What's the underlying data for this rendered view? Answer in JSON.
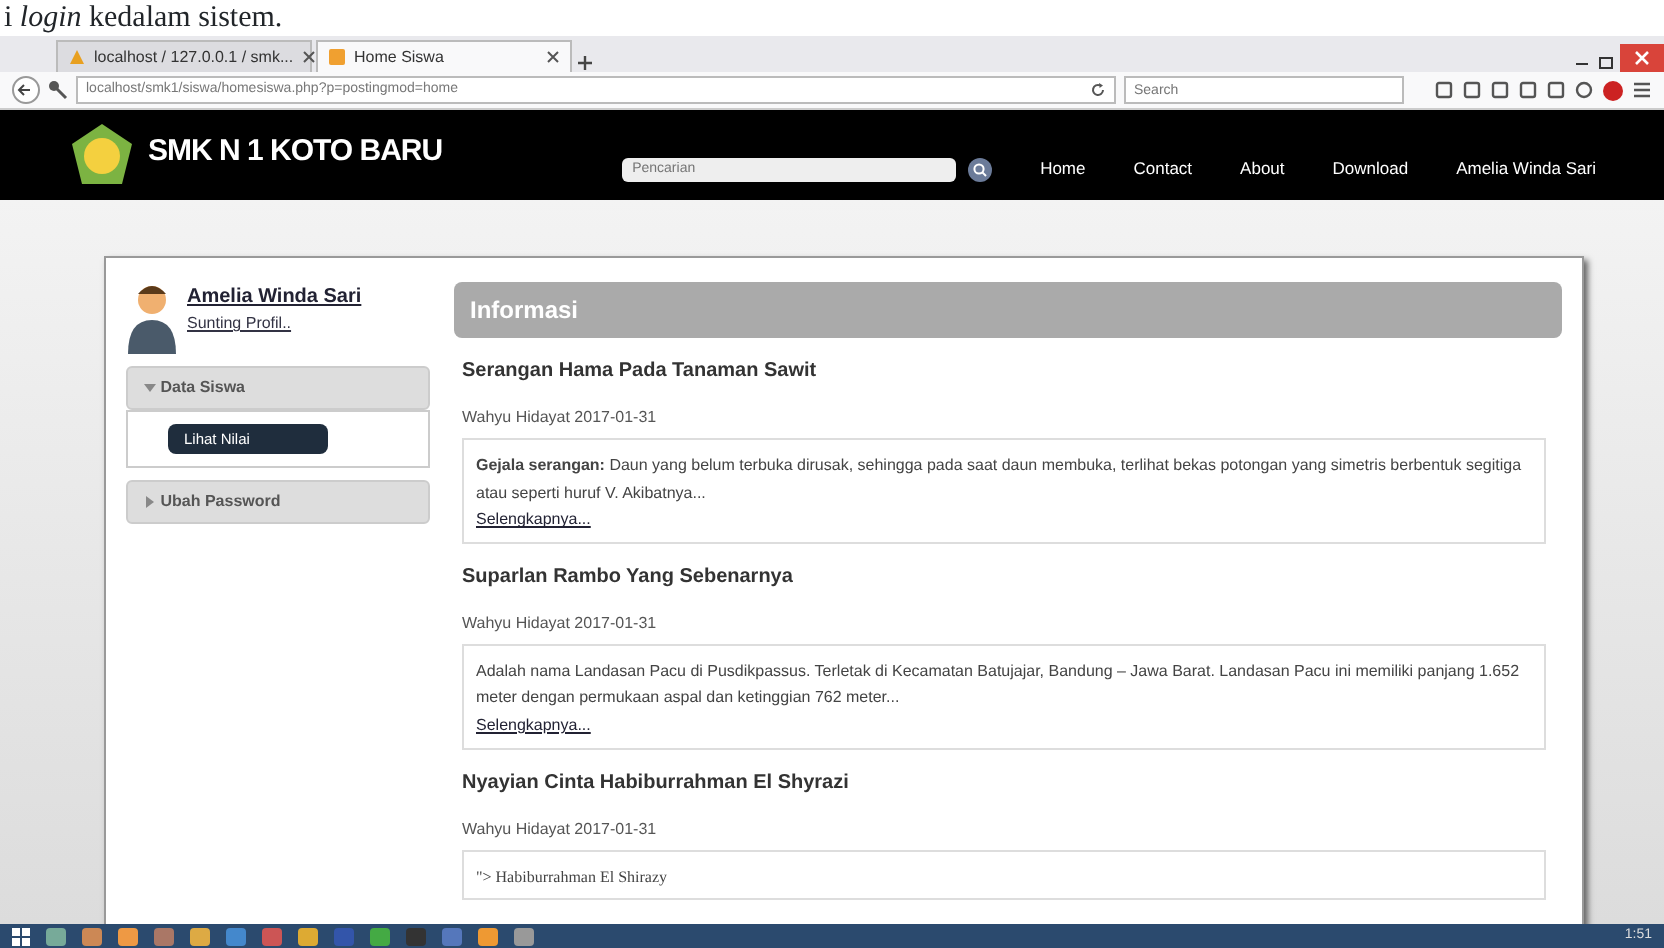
{
  "document_text": "i *login* kedalam sistem.",
  "browser": {
    "tabs": [
      {
        "title": "localhost / 127.0.0.1 / smk...",
        "selected": false
      },
      {
        "title": "Home Siswa",
        "selected": true
      }
    ],
    "url": "localhost/smk1/siswa/homesiswa.php?p=postingmod=home",
    "search_placeholder": "Search"
  },
  "navbar": {
    "brand": "SMK N 1 KOTO BARU",
    "search_placeholder": "Pencarian",
    "links": [
      "Home",
      "Contact",
      "About",
      "Download",
      "Amelia Winda Sari"
    ]
  },
  "sidebar": {
    "user_name": "Amelia Winda Sari",
    "edit_profile": "Sunting Profil..",
    "menus": [
      {
        "label": "Data Siswa",
        "expanded": true,
        "children": [
          {
            "label": "Lihat Nilai",
            "selected": true
          }
        ]
      },
      {
        "label": "Ubah Password",
        "expanded": false
      }
    ]
  },
  "content": {
    "heading": "Informasi",
    "posts": [
      {
        "title": "Serangan Hama Pada Tanaman Sawit",
        "meta": "Wahyu Hidayat 2017-01-31",
        "excerpt": "**Gejala serangan:** Daun yang belum terbuka dirusak, sehingga pada saat daun membuka, terlihat bekas potongan yang simetris berbentuk segitiga atau seperti huruf V. Akibatnya...",
        "more": "Selengkapnya..."
      },
      {
        "title": "Suparlan Rambo Yang Sebenarnya",
        "meta": "Wahyu Hidayat 2017-01-31",
        "excerpt": "Adalah nama Landasan Pacu di Pusdikpassus. Terletak di Kecamatan Batujajar, Bandung – Jawa Barat. Landasan Pacu ini memiliki panjang 1.652 meter dengan permukaan aspal dan ketinggian 762 meter...",
        "more": "Selengkapnya..."
      },
      {
        "title": "Nyayian Cinta Habiburrahman El Shyrazi",
        "meta": "Wahyu Hidayat 2017-01-31",
        "excerpt": "\"> Habiburrahman El Shirazy",
        "serif": true
      }
    ]
  },
  "taskbar": {
    "clock": "1:51"
  }
}
